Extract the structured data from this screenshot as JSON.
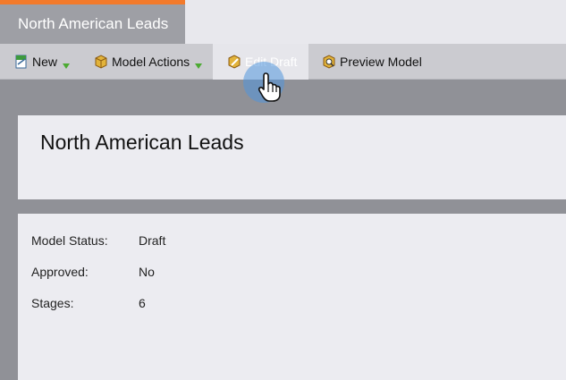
{
  "tab": {
    "label": "North American Leads"
  },
  "toolbar": {
    "new_label": "New",
    "model_actions_label": "Model Actions",
    "edit_draft_label": "Edit Draft",
    "preview_model_label": "Preview Model"
  },
  "panel": {
    "title": "North American Leads"
  },
  "details": [
    {
      "key": "Model Status:",
      "value": "Draft"
    },
    {
      "key": "Approved:",
      "value": "No"
    },
    {
      "key": "Stages:",
      "value": "6"
    }
  ],
  "colors": {
    "accent": "#f37a2b",
    "background": "#909197",
    "panel": "#ececf1",
    "toolbar": "#cbcbd0",
    "hover": "#5096dc"
  },
  "icons": [
    "new-icon",
    "chevron-down-icon",
    "model-actions-icon",
    "edit-draft-icon",
    "preview-model-icon",
    "hand-cursor-icon"
  ]
}
